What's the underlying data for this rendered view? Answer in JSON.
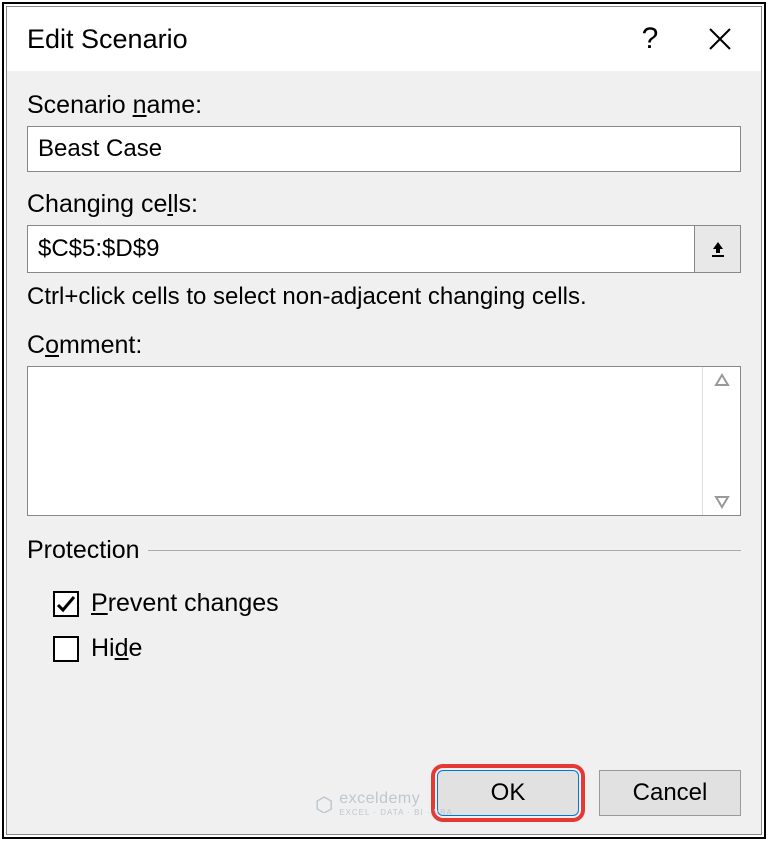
{
  "dialog": {
    "title": "Edit Scenario",
    "scenario_name": {
      "label_prefix": "Scenario ",
      "label_ul": "n",
      "label_suffix": "ame:",
      "value": "Beast Case"
    },
    "changing_cells": {
      "label_prefix": "Changing ce",
      "label_ul": "l",
      "label_suffix": "ls:",
      "value": "$C$5:$D$9"
    },
    "hint": "Ctrl+click cells to select non-adjacent changing cells.",
    "comment": {
      "label_prefix": "C",
      "label_ul": "o",
      "label_suffix": "mment:",
      "value": ""
    },
    "protection": {
      "legend": "Protection",
      "prevent_prefix": "",
      "prevent_ul": "P",
      "prevent_suffix": "revent changes",
      "prevent_checked": true,
      "hide_prefix": "Hi",
      "hide_ul": "d",
      "hide_suffix": "e",
      "hide_checked": false
    },
    "buttons": {
      "ok": "OK",
      "cancel": "Cancel"
    }
  },
  "watermark": {
    "brand": "exceldemy",
    "sub": "EXCEL · DATA · BI · VBA"
  }
}
